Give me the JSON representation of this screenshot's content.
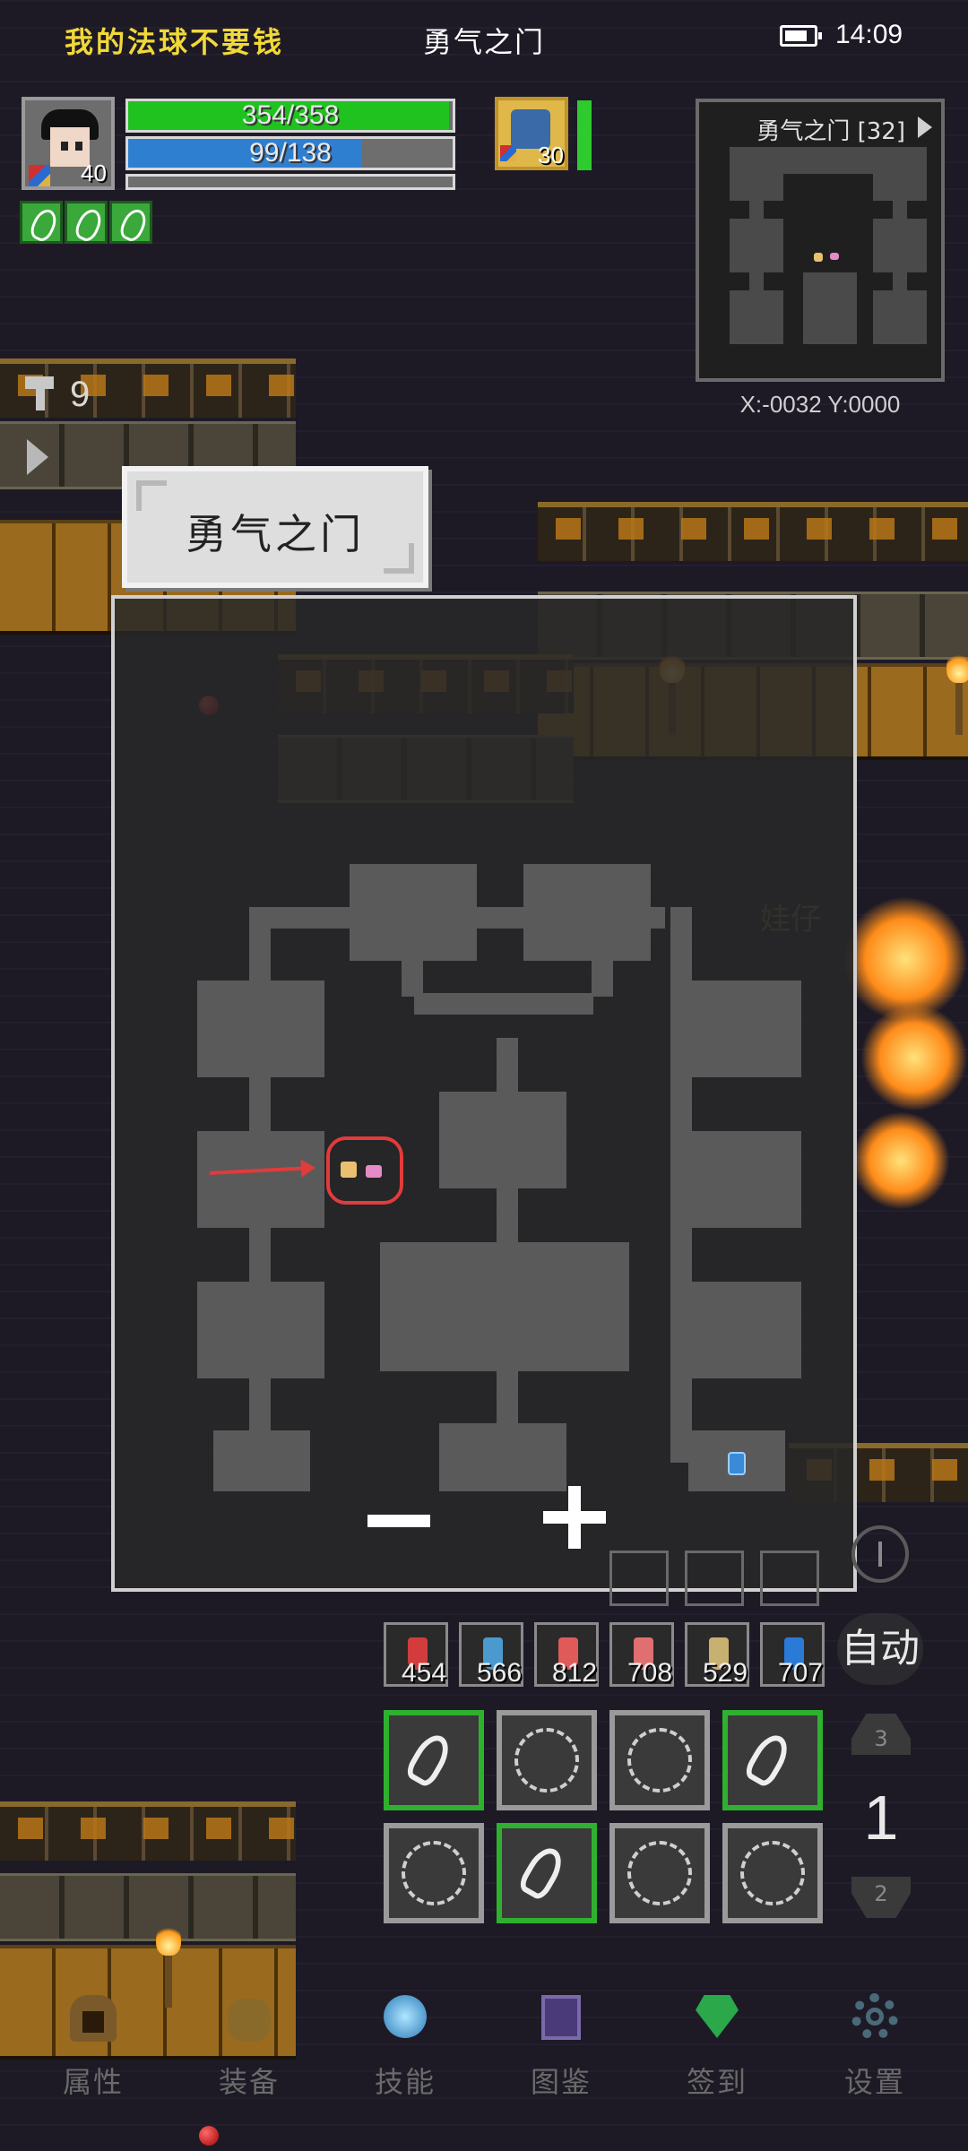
{
  "status_bar": {
    "player_name": "我的法球不要钱",
    "location": "勇气之门",
    "time": "14:09"
  },
  "player": {
    "level": "40",
    "hp": "354/358",
    "hp_fraction": 0.99,
    "mp": "99/138",
    "mp_fraction": 0.72
  },
  "pet": {
    "level": "30"
  },
  "minimap": {
    "title": "勇气之门 [32]",
    "coords": "X:-0032  Y:0000"
  },
  "keys": {
    "count": "9"
  },
  "map": {
    "title": "勇气之门",
    "npc_label": "娃仔"
  },
  "items": [
    {
      "name": "red-potion-icon",
      "count": "454",
      "color": "#d23c3c"
    },
    {
      "name": "fish-icon",
      "count": "566",
      "color": "#4a9ad0"
    },
    {
      "name": "health-potion-icon",
      "count": "812",
      "color": "#e05a5a"
    },
    {
      "name": "mana-potion-icon",
      "count": "708",
      "color": "#e07070"
    },
    {
      "name": "scroll-icon",
      "count": "529",
      "color": "#c8b070"
    },
    {
      "name": "blue-bird-icon",
      "count": "707",
      "color": "#2a7ad8"
    }
  ],
  "controls": {
    "auto_label": "自动",
    "floor_up": "3",
    "floor_current": "1",
    "floor_down": "2"
  },
  "nav": {
    "attributes": "属性",
    "equipment": "装备",
    "skills": "技能",
    "codex": "图鉴",
    "checkin": "签到",
    "settings": "设置"
  },
  "colors": {
    "hp_bar": "#1fc21f",
    "mp_bar": "#2f7fd0",
    "player_name": "#f1d83a",
    "highlight": "#e23b3b",
    "skill_active_border": "#2fb12f"
  }
}
